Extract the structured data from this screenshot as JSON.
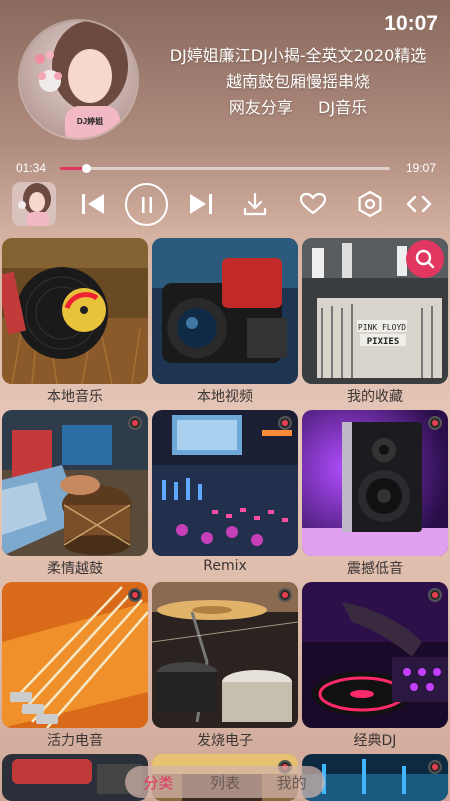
{
  "status": {
    "time": "10:07"
  },
  "now_playing": {
    "title_line1": "DJ婷姐廉江DJ小揭-全英文2020精选",
    "title_line2": "越南鼓包厢慢摇串烧",
    "source": "网友分享",
    "artist": "DJ音乐",
    "cover_caption": "DJ婷姐",
    "current_time": "01:34",
    "total_time": "19:07",
    "progress_fraction": 0.08
  },
  "controls": {
    "prev": "skip-previous-icon",
    "play_pause": "pause-icon",
    "next": "skip-next-icon",
    "download": "download-icon",
    "favorite": "heart-icon",
    "mode": "mode-icon",
    "share": "code-icon"
  },
  "categories": [
    {
      "label": "本地音乐"
    },
    {
      "label": "本地视频"
    },
    {
      "label": "我的收藏"
    },
    {
      "label": "柔情越鼓"
    },
    {
      "label": "Remix"
    },
    {
      "label": "震撼低音"
    },
    {
      "label": "活力电音"
    },
    {
      "label": "发烧电子"
    },
    {
      "label": "经典DJ"
    }
  ],
  "records_text": {
    "pink_floyd": "PINK FLOYD",
    "pixies": "PIXIES"
  },
  "bottom_nav": {
    "tabs": [
      {
        "label": "分类",
        "active": true
      },
      {
        "label": "列表",
        "active": false
      },
      {
        "label": "我的",
        "active": false
      }
    ]
  },
  "colors": {
    "accent": "#e0365f"
  }
}
